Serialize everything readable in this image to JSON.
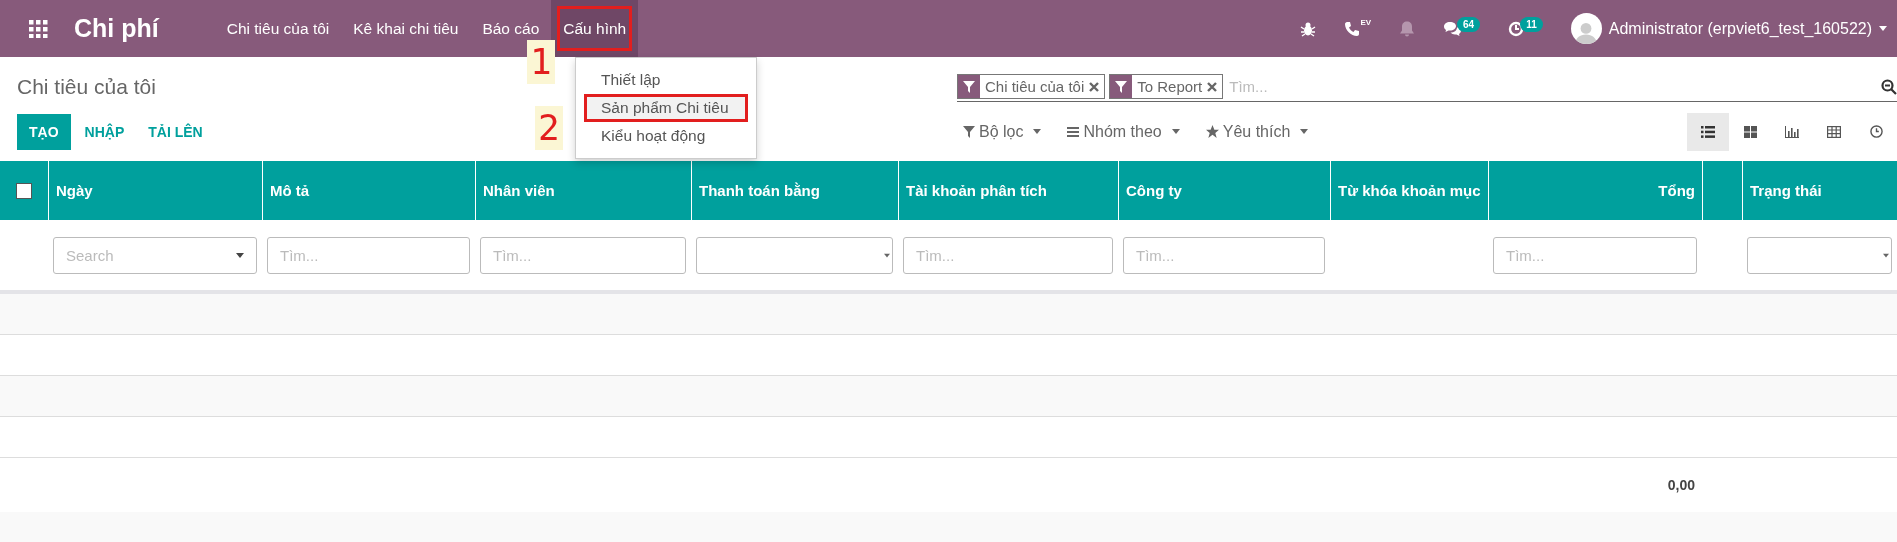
{
  "navbar": {
    "app_title": "Chi phí",
    "menus": [
      {
        "label": "Chi tiêu của tôi",
        "selected": false,
        "highlighted": false
      },
      {
        "label": "Kê khai chi tiêu",
        "selected": false,
        "highlighted": false
      },
      {
        "label": "Báo cáo",
        "selected": false,
        "highlighted": false
      },
      {
        "label": "Cấu hình",
        "selected": true,
        "highlighted": true
      }
    ],
    "systray": [
      {
        "kind": "bug"
      },
      {
        "kind": "phone",
        "text": "EV"
      },
      {
        "kind": "bell"
      },
      {
        "kind": "chat",
        "badge": "64"
      },
      {
        "kind": "activity",
        "badge": "11"
      }
    ],
    "user": "Administrator (erpviet6_test_160522)"
  },
  "dropdown": {
    "items": [
      {
        "label": "Thiết lập",
        "selected": false,
        "highlighted": false
      },
      {
        "label": "Sản phẩm Chi tiêu",
        "selected": true,
        "highlighted": true
      },
      {
        "label": "Kiểu hoạt động",
        "selected": false,
        "highlighted": false
      }
    ]
  },
  "annotations": [
    {
      "label": "1"
    },
    {
      "label": "2"
    }
  ],
  "breadcrumb": "Chi tiêu của tôi",
  "buttons": [
    {
      "label": "TẠO",
      "kind": "primary"
    },
    {
      "label": "NHẬP",
      "kind": "link"
    },
    {
      "label": "TẢI LÊN",
      "kind": "link"
    }
  ],
  "search": {
    "facets": [
      "Chi tiêu của tôi",
      "To Report"
    ],
    "placeholder": "Tìm..."
  },
  "search_options": [
    {
      "label": "Bộ lọc",
      "kind": "filter"
    },
    {
      "label": "Nhóm theo",
      "kind": "group"
    },
    {
      "label": "Yêu thích",
      "kind": "star"
    }
  ],
  "views": [
    {
      "kind": "list",
      "selected": true
    },
    {
      "kind": "kanban",
      "selected": false
    },
    {
      "kind": "graph",
      "selected": false
    },
    {
      "kind": "pivot",
      "selected": false
    },
    {
      "kind": "activity",
      "selected": false
    }
  ],
  "table": {
    "select_all": {
      "checked": false
    },
    "columns": [
      {
        "label": "Ngày",
        "kind": "text",
        "filter": {
          "kind": "select",
          "placeholder": "Search"
        }
      },
      {
        "label": "Mô tả",
        "kind": "text",
        "filter": {
          "kind": "input",
          "placeholder": "Tìm..."
        }
      },
      {
        "label": "Nhân viên",
        "kind": "text",
        "filter": {
          "kind": "input",
          "placeholder": "Tìm..."
        }
      },
      {
        "label": "Thanh toán bằng",
        "kind": "text",
        "filter": {
          "kind": "select"
        }
      },
      {
        "label": "Tài khoản phân tích",
        "kind": "text",
        "filter": {
          "kind": "input",
          "placeholder": "Tìm..."
        }
      },
      {
        "label": "Công ty",
        "kind": "text",
        "filter": {
          "kind": "input",
          "placeholder": "Tìm..."
        }
      },
      {
        "label": "Từ khóa khoản mục",
        "kind": "text"
      },
      {
        "label": "Tổng",
        "kind": "amount",
        "filter": {
          "kind": "input",
          "placeholder": "Tìm..."
        },
        "total": "0,00"
      },
      {
        "kind": "text"
      },
      {
        "label": "Trạng thái",
        "kind": "text",
        "filter": {
          "kind": "select"
        }
      }
    ]
  }
}
